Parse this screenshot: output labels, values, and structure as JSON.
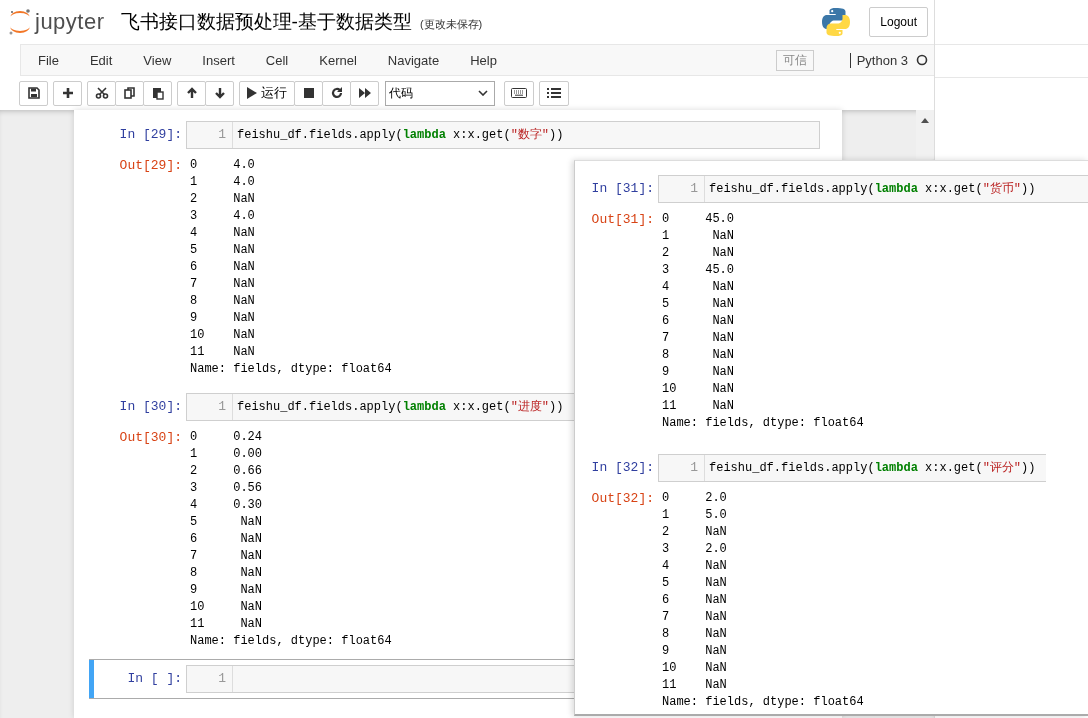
{
  "header": {
    "logo_text": "jupyter",
    "title": "飞书接口数据预处理-基于数据类型",
    "save_status": "(更改未保存)",
    "logout": "Logout"
  },
  "menubar": {
    "items": [
      "File",
      "Edit",
      "View",
      "Insert",
      "Cell",
      "Kernel",
      "Navigate",
      "Help"
    ],
    "trusted": "可信",
    "kernel": "Python 3",
    "kernel_busy": false
  },
  "toolbar": {
    "run_label": "运行",
    "cell_type": "代码"
  },
  "cells": [
    {
      "selected": false,
      "prompt": "In [29]:",
      "line_number": "1",
      "code": [
        {
          "kind": "plain",
          "text": "feishu_df.fields.apply("
        },
        {
          "kind": "keyword",
          "text": "lambda"
        },
        {
          "kind": "plain",
          "text": " x:x.get("
        },
        {
          "kind": "string",
          "text": "\"数字\""
        },
        {
          "kind": "plain",
          "text": "))"
        }
      ],
      "output_prompt": "Out[29]:",
      "output": [
        "0     4.0",
        "1     4.0",
        "2     NaN",
        "3     4.0",
        "4     NaN",
        "5     NaN",
        "6     NaN",
        "7     NaN",
        "8     NaN",
        "9     NaN",
        "10    NaN",
        "11    NaN",
        "Name: fields, dtype: float64"
      ]
    },
    {
      "selected": false,
      "prompt": "In [30]:",
      "line_number": "1",
      "code": [
        {
          "kind": "plain",
          "text": "feishu_df.fields.apply("
        },
        {
          "kind": "keyword",
          "text": "lambda"
        },
        {
          "kind": "plain",
          "text": " x:x.get("
        },
        {
          "kind": "string",
          "text": "\"进度\""
        },
        {
          "kind": "plain",
          "text": "))"
        }
      ],
      "output_prompt": "Out[30]:",
      "output": [
        "0     0.24",
        "1     0.00",
        "2     0.66",
        "3     0.56",
        "4     0.30",
        "5      NaN",
        "6      NaN",
        "7      NaN",
        "8      NaN",
        "9      NaN",
        "10     NaN",
        "11     NaN",
        "Name: fields, dtype: float64"
      ]
    },
    {
      "selected": true,
      "prompt": "In [ ]:",
      "line_number": "1"
    }
  ],
  "overlay": {
    "cells": [
      {
        "selected": false,
        "prompt": "In [31]:",
        "line_number": "1",
        "code": [
          {
            "kind": "plain",
            "text": "feishu_df.fields.apply("
          },
          {
            "kind": "keyword",
            "text": "lambda"
          },
          {
            "kind": "plain",
            "text": " x:x.get("
          },
          {
            "kind": "string",
            "text": "\"货币\""
          },
          {
            "kind": "plain",
            "text": "))"
          }
        ],
        "output_prompt": "Out[31]:",
        "output": [
          "0     45.0",
          "1      NaN",
          "2      NaN",
          "3     45.0",
          "4      NaN",
          "5      NaN",
          "6      NaN",
          "7      NaN",
          "8      NaN",
          "9      NaN",
          "10     NaN",
          "11     NaN",
          "Name: fields, dtype: float64"
        ]
      },
      {
        "selected": false,
        "prompt": "In [32]:",
        "line_number": "1",
        "code": [
          {
            "kind": "plain",
            "text": "feishu_df.fields.apply("
          },
          {
            "kind": "keyword",
            "text": "lambda"
          },
          {
            "kind": "plain",
            "text": " x:x.get("
          },
          {
            "kind": "string",
            "text": "\"评分\""
          },
          {
            "kind": "plain",
            "text": "))"
          }
        ],
        "output_prompt": "Out[32]:",
        "output": [
          "0     2.0",
          "1     5.0",
          "2     NaN",
          "3     2.0",
          "4     NaN",
          "5     NaN",
          "6     NaN",
          "7     NaN",
          "8     NaN",
          "9     NaN",
          "10    NaN",
          "11    NaN",
          "Name: fields, dtype: float64"
        ]
      }
    ]
  }
}
